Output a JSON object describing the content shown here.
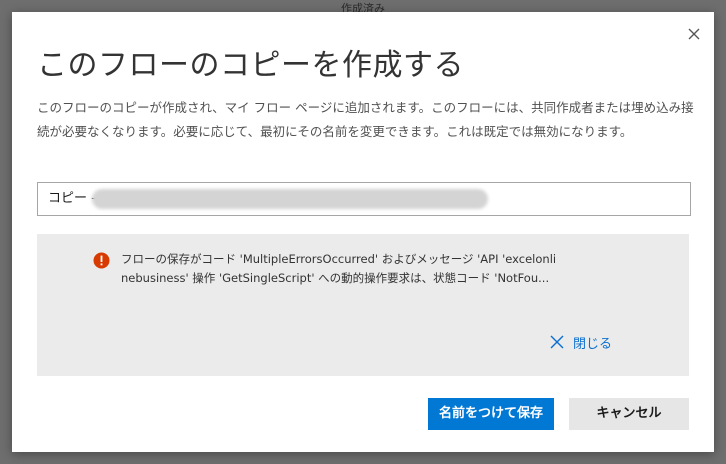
{
  "backdrop": {
    "top_text": "作成済み"
  },
  "dialog": {
    "title": "このフローのコピーを作成する",
    "description": "このフローのコピーが作成され、マイ フロー ページに追加されます。このフローには、共同作成者または埋め込み接続が必要なくなります。必要に応じて、最初にその名前を変更できます。これは既定では無効になります。",
    "name_input": {
      "prefix": "コピー -"
    },
    "error": {
      "message": "フローの保存がコード 'MultipleErrorsOccurred' およびメッセージ 'API 'excelonlinebusiness' 操作 'GetSingleScript' への動的操作要求は、状態コード 'NotFou...",
      "close_label": "閉じる"
    },
    "buttons": {
      "save_label": "名前をつけて保存",
      "cancel_label": "キャンセル"
    }
  },
  "colors": {
    "primary": "#0078d4",
    "error_icon": "#d83b01",
    "link": "#0b6fcf"
  }
}
